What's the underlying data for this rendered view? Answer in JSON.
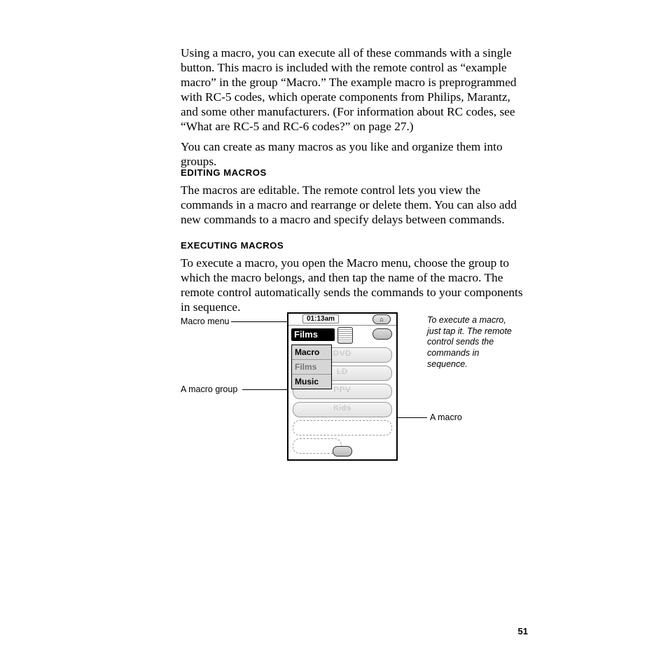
{
  "paragraphs": {
    "p1": "Using a macro, you can execute all of these commands with a single button. This macro is included with the remote control as “example macro” in the group “Macro.” The example macro is preprogrammed with RC-5 codes, which operate components from Philips, Marantz, and some other manufacturers. (For information about RC codes, see “What are RC-5 and RC-6 codes?” on page 27.)",
    "p2": "You can create as many macros as you like and organize them into groups.",
    "heading1": "EDITING MACROS",
    "p3": "The macros are editable. The remote control lets you view the commands in a macro and rearrange or delete them. You can also add new commands to a macro and specify delays between commands.",
    "heading2": "EXECUTING MACROS",
    "p4": "To execute a macro, you open the Macro menu, choose the group to which the macro belongs, and then tap the name of the macro. The remote control automatically sends the commands to your components in sequence."
  },
  "diagram": {
    "labels": {
      "macro_menu": "Macro menu",
      "macro_group": "A macro group",
      "a_macro": "A macro",
      "caption": "To execute a macro, just tap it. The remote control sends the commands in sequence."
    },
    "remote": {
      "time": "01:13am",
      "title": "Films",
      "menu_items": [
        "Macro",
        "Films",
        "Music"
      ],
      "menu_selected_index": 1,
      "rows": [
        "DVD",
        "LD",
        "PPV",
        "Kids"
      ]
    }
  },
  "page_number": "51"
}
